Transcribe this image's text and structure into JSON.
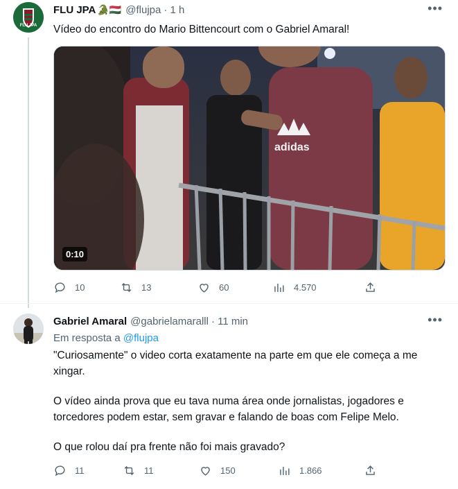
{
  "tweet1": {
    "name": "FLU JPA",
    "emojis": "🐊🇭🇺",
    "handle": "@flujpa",
    "time": "· 1 h",
    "text": "Vídeo do encontro do Mario Bittencourt com o Gabriel Amaral!",
    "avatar_text": "FLU JPA",
    "video": {
      "duration": "0:10",
      "shirt_text": "adidas"
    },
    "actions": {
      "replies": "10",
      "retweets": "13",
      "likes": "60",
      "views": "4.570"
    }
  },
  "tweet2": {
    "name": "Gabriel Amaral",
    "handle": "@gabrielamaralll",
    "time": "· 11 min",
    "reply_prefix": "Em resposta a",
    "reply_to": "@flujpa",
    "paragraphs": [
      "\"Curiosamente\" o video corta exatamente na parte em que ele começa a me xingar.",
      "O vídeo ainda prova que eu tava numa área onde jornalistas, jogadores e torcedores podem estar, sem gravar e falando de boas com Felipe Melo.",
      "O que rolou daí pra frente não foi mais gravado?"
    ],
    "actions": {
      "replies": "11",
      "retweets": "11",
      "likes": "150",
      "views": "1.866"
    }
  },
  "more_icon": "more-horizontal-icon",
  "colors": {
    "link": "#1d9bf0",
    "muted": "#536471",
    "brand_green": "#1b6b3a",
    "brand_red": "#8b1a2b"
  }
}
